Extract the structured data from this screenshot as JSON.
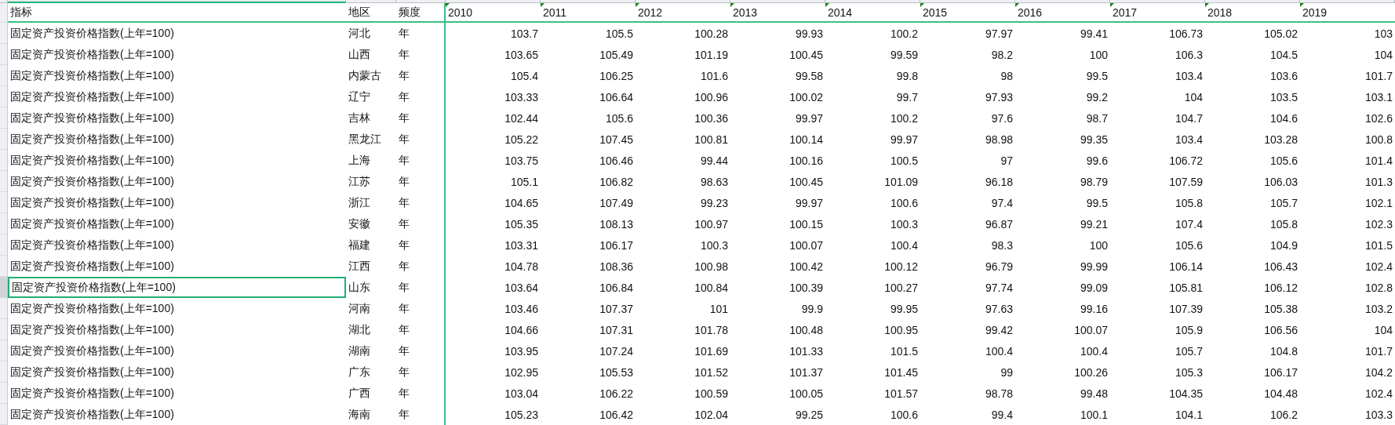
{
  "columns": [
    {
      "label": "指标",
      "flagged": false
    },
    {
      "label": "地区",
      "flagged": false
    },
    {
      "label": "频度",
      "flagged": false
    },
    {
      "label": "2010",
      "flagged": true
    },
    {
      "label": "2011",
      "flagged": true
    },
    {
      "label": "2012",
      "flagged": true
    },
    {
      "label": "2013",
      "flagged": true
    },
    {
      "label": "2014",
      "flagged": true
    },
    {
      "label": "2015",
      "flagged": true
    },
    {
      "label": "2016",
      "flagged": true
    },
    {
      "label": "2017",
      "flagged": true
    },
    {
      "label": "2018",
      "flagged": true
    },
    {
      "label": "2019",
      "flagged": true
    }
  ],
  "rows": [
    {
      "indicator": "固定资产投资价格指数(上年=100)",
      "region": "河北",
      "frequency": "年",
      "selected": false,
      "values": [
        "103.7",
        "105.5",
        "100.28",
        "99.93",
        "100.2",
        "97.97",
        "99.41",
        "106.73",
        "105.02",
        "103"
      ]
    },
    {
      "indicator": "固定资产投资价格指数(上年=100)",
      "region": "山西",
      "frequency": "年",
      "selected": false,
      "values": [
        "103.65",
        "105.49",
        "101.19",
        "100.45",
        "99.59",
        "98.2",
        "100",
        "106.3",
        "104.5",
        "104"
      ]
    },
    {
      "indicator": "固定资产投资价格指数(上年=100)",
      "region": "内蒙古",
      "frequency": "年",
      "selected": false,
      "values": [
        "105.4",
        "106.25",
        "101.6",
        "99.58",
        "99.8",
        "98",
        "99.5",
        "103.4",
        "103.6",
        "101.7"
      ]
    },
    {
      "indicator": "固定资产投资价格指数(上年=100)",
      "region": "辽宁",
      "frequency": "年",
      "selected": false,
      "values": [
        "103.33",
        "106.64",
        "100.96",
        "100.02",
        "99.7",
        "97.93",
        "99.2",
        "104",
        "103.5",
        "103.1"
      ]
    },
    {
      "indicator": "固定资产投资价格指数(上年=100)",
      "region": "吉林",
      "frequency": "年",
      "selected": false,
      "values": [
        "102.44",
        "105.6",
        "100.36",
        "99.97",
        "100.2",
        "97.6",
        "98.7",
        "104.7",
        "104.6",
        "102.6"
      ]
    },
    {
      "indicator": "固定资产投资价格指数(上年=100)",
      "region": "黑龙江",
      "frequency": "年",
      "selected": false,
      "values": [
        "105.22",
        "107.45",
        "100.81",
        "100.14",
        "99.97",
        "98.98",
        "99.35",
        "103.4",
        "103.28",
        "100.8"
      ]
    },
    {
      "indicator": "固定资产投资价格指数(上年=100)",
      "region": "上海",
      "frequency": "年",
      "selected": false,
      "values": [
        "103.75",
        "106.46",
        "99.44",
        "100.16",
        "100.5",
        "97",
        "99.6",
        "106.72",
        "105.6",
        "101.4"
      ]
    },
    {
      "indicator": "固定资产投资价格指数(上年=100)",
      "region": "江苏",
      "frequency": "年",
      "selected": false,
      "values": [
        "105.1",
        "106.82",
        "98.63",
        "100.45",
        "101.09",
        "96.18",
        "98.79",
        "107.59",
        "106.03",
        "101.3"
      ]
    },
    {
      "indicator": "固定资产投资价格指数(上年=100)",
      "region": "浙江",
      "frequency": "年",
      "selected": false,
      "values": [
        "104.65",
        "107.49",
        "99.23",
        "99.97",
        "100.6",
        "97.4",
        "99.5",
        "105.8",
        "105.7",
        "102.1"
      ]
    },
    {
      "indicator": "固定资产投资价格指数(上年=100)",
      "region": "安徽",
      "frequency": "年",
      "selected": false,
      "values": [
        "105.35",
        "108.13",
        "100.97",
        "100.15",
        "100.3",
        "96.87",
        "99.21",
        "107.4",
        "105.8",
        "102.3"
      ]
    },
    {
      "indicator": "固定资产投资价格指数(上年=100)",
      "region": "福建",
      "frequency": "年",
      "selected": false,
      "values": [
        "103.31",
        "106.17",
        "100.3",
        "100.07",
        "100.4",
        "98.3",
        "100",
        "105.6",
        "104.9",
        "101.5"
      ]
    },
    {
      "indicator": "固定资产投资价格指数(上年=100)",
      "region": "江西",
      "frequency": "年",
      "selected": false,
      "values": [
        "104.78",
        "108.36",
        "100.98",
        "100.42",
        "100.12",
        "96.79",
        "99.99",
        "106.14",
        "106.43",
        "102.4"
      ]
    },
    {
      "indicator": "固定资产投资价格指数(上年=100)",
      "region": "山东",
      "frequency": "年",
      "selected": true,
      "values": [
        "103.64",
        "106.84",
        "100.84",
        "100.39",
        "100.27",
        "97.74",
        "99.09",
        "105.81",
        "106.12",
        "102.8"
      ]
    },
    {
      "indicator": "固定资产投资价格指数(上年=100)",
      "region": "河南",
      "frequency": "年",
      "selected": false,
      "values": [
        "103.46",
        "107.37",
        "101",
        "99.9",
        "99.95",
        "97.63",
        "99.16",
        "107.39",
        "105.38",
        "103.2"
      ]
    },
    {
      "indicator": "固定资产投资价格指数(上年=100)",
      "region": "湖北",
      "frequency": "年",
      "selected": false,
      "values": [
        "104.66",
        "107.31",
        "101.78",
        "100.48",
        "100.95",
        "99.42",
        "100.07",
        "105.9",
        "106.56",
        "104"
      ]
    },
    {
      "indicator": "固定资产投资价格指数(上年=100)",
      "region": "湖南",
      "frequency": "年",
      "selected": false,
      "values": [
        "103.95",
        "107.24",
        "101.69",
        "101.33",
        "101.5",
        "100.4",
        "100.4",
        "105.7",
        "104.8",
        "101.7"
      ]
    },
    {
      "indicator": "固定资产投资价格指数(上年=100)",
      "region": "广东",
      "frequency": "年",
      "selected": false,
      "values": [
        "102.95",
        "105.53",
        "101.52",
        "101.37",
        "101.45",
        "99",
        "100.26",
        "105.3",
        "106.17",
        "104.2"
      ]
    },
    {
      "indicator": "固定资产投资价格指数(上年=100)",
      "region": "广西",
      "frequency": "年",
      "selected": false,
      "values": [
        "103.04",
        "106.22",
        "100.59",
        "100.05",
        "101.57",
        "98.78",
        "99.48",
        "104.35",
        "104.48",
        "102.4"
      ]
    },
    {
      "indicator": "固定资产投资价格指数(上年=100)",
      "region": "海南",
      "frequency": "年",
      "selected": false,
      "values": [
        "105.23",
        "106.42",
        "102.04",
        "99.25",
        "100.6",
        "99.4",
        "100.1",
        "104.1",
        "106.2",
        "103.3"
      ]
    }
  ]
}
